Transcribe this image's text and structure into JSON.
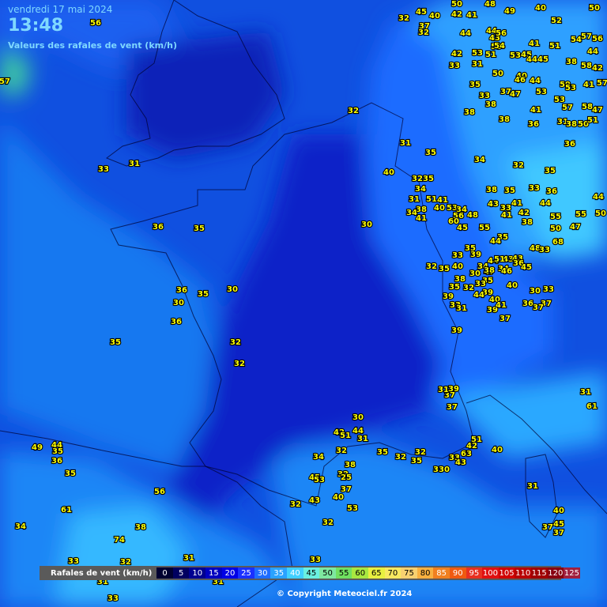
{
  "header": {
    "date": "vendredi 17 mai 2024",
    "time": "13:48",
    "title": "Valeurs des rafales de vent (km/h)"
  },
  "legend": {
    "label": "Rafales de vent (km/h)",
    "items": [
      {
        "v": "0",
        "c": "#000030"
      },
      {
        "v": "5",
        "c": "#000060"
      },
      {
        "v": "10",
        "c": "#000090"
      },
      {
        "v": "15",
        "c": "#0000c0"
      },
      {
        "v": "20",
        "c": "#0000e6"
      },
      {
        "v": "25",
        "c": "#1a30ff"
      },
      {
        "v": "30",
        "c": "#1e6cff"
      },
      {
        "v": "35",
        "c": "#2aa2ff"
      },
      {
        "v": "40",
        "c": "#40d0ff"
      },
      {
        "v": "45",
        "c": "#6af0e0"
      },
      {
        "v": "50",
        "c": "#7ee8a0"
      },
      {
        "v": "55",
        "c": "#70e060"
      },
      {
        "v": "60",
        "c": "#a8e840"
      },
      {
        "v": "65",
        "c": "#e8f040"
      },
      {
        "v": "70",
        "c": "#f8e860"
      },
      {
        "v": "75",
        "c": "#f8d070"
      },
      {
        "v": "80",
        "c": "#f8b040"
      },
      {
        "v": "85",
        "c": "#f08020"
      },
      {
        "v": "90",
        "c": "#f05a10"
      },
      {
        "v": "95",
        "c": "#e83020"
      },
      {
        "v": "100",
        "c": "#e01010"
      },
      {
        "v": "105",
        "c": "#d00000"
      },
      {
        "v": "110",
        "c": "#b80000"
      },
      {
        "v": "115",
        "c": "#a00000"
      },
      {
        "v": "120",
        "c": "#880010"
      },
      {
        "v": "125",
        "c": "#a02040"
      }
    ]
  },
  "copyright": "© Copyright Meteociel.fr 2024",
  "stations": [
    [
      "56",
      121,
      28
    ],
    [
      "57",
      6,
      102
    ],
    [
      "32",
      511,
      22
    ],
    [
      "45",
      533,
      14
    ],
    [
      "40",
      550,
      19
    ],
    [
      "37",
      537,
      32
    ],
    [
      "32",
      536,
      40
    ],
    [
      "50",
      578,
      4
    ],
    [
      "42",
      578,
      17
    ],
    [
      "41",
      597,
      18
    ],
    [
      "48",
      620,
      4
    ],
    [
      "49",
      645,
      13
    ],
    [
      "40",
      684,
      9
    ],
    [
      "52",
      704,
      25
    ],
    [
      "50",
      752,
      9
    ],
    [
      "44",
      589,
      41
    ],
    [
      "44",
      622,
      38
    ],
    [
      "43",
      626,
      47
    ],
    [
      "56",
      634,
      41
    ],
    [
      "53",
      628,
      58
    ],
    [
      "54",
      632,
      57
    ],
    [
      "42",
      578,
      67
    ],
    [
      "53",
      604,
      66
    ],
    [
      "51",
      621,
      68
    ],
    [
      "31",
      604,
      80
    ],
    [
      "33",
      575,
      82
    ],
    [
      "50",
      630,
      92
    ],
    [
      "53",
      652,
      69
    ],
    [
      "41",
      676,
      54
    ],
    [
      "45",
      666,
      68
    ],
    [
      "44",
      673,
      74
    ],
    [
      "45",
      687,
      74
    ],
    [
      "51",
      702,
      57
    ],
    [
      "54",
      729,
      49
    ],
    [
      "57",
      742,
      45
    ],
    [
      "56",
      756,
      48
    ],
    [
      "44",
      750,
      64
    ],
    [
      "38",
      723,
      77
    ],
    [
      "58",
      742,
      82
    ],
    [
      "42",
      756,
      85
    ],
    [
      "59",
      715,
      106
    ],
    [
      "53",
      722,
      110
    ],
    [
      "41",
      745,
      106
    ],
    [
      "57",
      762,
      104
    ],
    [
      "35",
      601,
      106
    ],
    [
      "40",
      660,
      95
    ],
    [
      "46",
      658,
      100
    ],
    [
      "37",
      640,
      115
    ],
    [
      "47",
      652,
      118
    ],
    [
      "44",
      677,
      101
    ],
    [
      "53",
      685,
      115
    ],
    [
      "33",
      613,
      120
    ],
    [
      "38",
      621,
      131
    ],
    [
      "53",
      708,
      125
    ],
    [
      "57",
      718,
      135
    ],
    [
      "58",
      743,
      134
    ],
    [
      "47",
      756,
      138
    ],
    [
      "38",
      594,
      141
    ],
    [
      "38",
      638,
      150
    ],
    [
      "41",
      678,
      138
    ],
    [
      "36",
      675,
      156
    ],
    [
      "31",
      712,
      153
    ],
    [
      "38",
      723,
      156
    ],
    [
      "50",
      738,
      156
    ],
    [
      "51",
      750,
      151
    ],
    [
      "36",
      721,
      181
    ],
    [
      "32",
      447,
      139
    ],
    [
      "31",
      513,
      180
    ],
    [
      "35",
      545,
      192
    ],
    [
      "34",
      607,
      201
    ],
    [
      "32",
      656,
      208
    ],
    [
      "35",
      696,
      215
    ],
    [
      "40",
      492,
      217
    ],
    [
      "33",
      131,
      213
    ],
    [
      "31",
      170,
      206
    ],
    [
      "32",
      528,
      225
    ],
    [
      "35",
      542,
      225
    ],
    [
      "34",
      532,
      238
    ],
    [
      "31",
      524,
      251
    ],
    [
      "51",
      546,
      251
    ],
    [
      "41",
      560,
      252
    ],
    [
      "38",
      622,
      239
    ],
    [
      "35",
      645,
      240
    ],
    [
      "33",
      676,
      237
    ],
    [
      "36",
      698,
      241
    ],
    [
      "44",
      757,
      248
    ],
    [
      "43",
      624,
      257
    ],
    [
      "41",
      654,
      256
    ],
    [
      "44",
      690,
      256
    ],
    [
      "40",
      556,
      262
    ],
    [
      "53",
      572,
      262
    ],
    [
      "34",
      584,
      264
    ],
    [
      "33",
      640,
      262
    ],
    [
      "42",
      663,
      268
    ],
    [
      "55",
      703,
      273
    ],
    [
      "55",
      735,
      270
    ],
    [
      "50",
      760,
      269
    ],
    [
      "38",
      533,
      264
    ],
    [
      "34",
      521,
      268
    ],
    [
      "56",
      580,
      272
    ],
    [
      "48",
      598,
      271
    ],
    [
      "41",
      641,
      271
    ],
    [
      "38",
      667,
      280
    ],
    [
      "41",
      533,
      275
    ],
    [
      "60",
      574,
      279
    ],
    [
      "47",
      728,
      286
    ],
    [
      "45",
      585,
      287
    ],
    [
      "55",
      613,
      287
    ],
    [
      "50",
      703,
      288
    ],
    [
      "30",
      464,
      283
    ],
    [
      "36",
      200,
      286
    ],
    [
      "35",
      252,
      288
    ],
    [
      "35",
      636,
      299
    ],
    [
      "44",
      627,
      304
    ],
    [
      "68",
      706,
      305
    ],
    [
      "35",
      595,
      313
    ],
    [
      "39",
      602,
      321
    ],
    [
      "48",
      677,
      313
    ],
    [
      "33",
      689,
      315
    ],
    [
      "33",
      579,
      322
    ],
    [
      "43",
      643,
      327
    ],
    [
      "44",
      624,
      329
    ],
    [
      "51",
      632,
      327
    ],
    [
      "43",
      655,
      326
    ],
    [
      "32",
      546,
      336
    ],
    [
      "35",
      562,
      339
    ],
    [
      "40",
      579,
      336
    ],
    [
      "34",
      611,
      336
    ],
    [
      "47",
      619,
      343
    ],
    [
      "34",
      637,
      339
    ],
    [
      "36",
      656,
      332
    ],
    [
      "45",
      666,
      337
    ],
    [
      "38",
      619,
      341
    ],
    [
      "30",
      601,
      345
    ],
    [
      "38",
      582,
      352
    ],
    [
      "46",
      641,
      342
    ],
    [
      "35",
      617,
      354
    ],
    [
      "30",
      294,
      365
    ],
    [
      "36",
      230,
      366
    ],
    [
      "35",
      257,
      371
    ],
    [
      "30",
      226,
      382
    ],
    [
      "35",
      575,
      362
    ],
    [
      "32",
      593,
      363
    ],
    [
      "33",
      608,
      358
    ],
    [
      "39",
      617,
      369
    ],
    [
      "40",
      648,
      360
    ],
    [
      "30",
      677,
      367
    ],
    [
      "33",
      694,
      365
    ],
    [
      "39",
      567,
      374
    ],
    [
      "44",
      606,
      372
    ],
    [
      "40",
      626,
      378
    ],
    [
      "36",
      668,
      383
    ],
    [
      "37",
      691,
      383
    ],
    [
      "33",
      576,
      385
    ],
    [
      "31",
      584,
      389
    ],
    [
      "39",
      623,
      391
    ],
    [
      "41",
      634,
      385
    ],
    [
      "37",
      681,
      388
    ],
    [
      "36",
      223,
      406
    ],
    [
      "37",
      639,
      402
    ],
    [
      "35",
      146,
      432
    ],
    [
      "39",
      578,
      417
    ],
    [
      "32",
      298,
      432
    ],
    [
      "32",
      303,
      459
    ],
    [
      "37",
      569,
      499
    ],
    [
      "31",
      561,
      492
    ],
    [
      "39",
      574,
      491
    ],
    [
      "37",
      572,
      514
    ],
    [
      "31",
      741,
      495
    ],
    [
      "61",
      749,
      513
    ],
    [
      "30",
      453,
      527
    ],
    [
      "42",
      429,
      546
    ],
    [
      "51",
      437,
      550
    ],
    [
      "44",
      453,
      544
    ],
    [
      "31",
      459,
      554
    ],
    [
      "32",
      432,
      569
    ],
    [
      "34",
      403,
      577
    ],
    [
      "38",
      443,
      587
    ],
    [
      "35",
      484,
      571
    ],
    [
      "32",
      507,
      577
    ],
    [
      "32",
      532,
      571
    ],
    [
      "35",
      527,
      582
    ],
    [
      "33",
      575,
      578
    ],
    [
      "43",
      583,
      584
    ],
    [
      "63",
      590,
      573
    ],
    [
      "42",
      597,
      563
    ],
    [
      "51",
      603,
      555
    ],
    [
      "40",
      629,
      568
    ],
    [
      "33",
      555,
      593
    ],
    [
      "30",
      562,
      593
    ],
    [
      "45",
      398,
      603
    ],
    [
      "53",
      404,
      606
    ],
    [
      "32",
      434,
      599
    ],
    [
      "25",
      438,
      603
    ],
    [
      "37",
      438,
      618
    ],
    [
      "49",
      47,
      565
    ],
    [
      "44",
      72,
      562
    ],
    [
      "35",
      73,
      570
    ],
    [
      "36",
      72,
      582
    ],
    [
      "35",
      89,
      598
    ],
    [
      "56",
      202,
      621
    ],
    [
      "40",
      428,
      628
    ],
    [
      "53",
      446,
      642
    ],
    [
      "32",
      374,
      637
    ],
    [
      "43",
      398,
      632
    ],
    [
      "31",
      674,
      614
    ],
    [
      "40",
      707,
      645
    ],
    [
      "37",
      693,
      666
    ],
    [
      "45",
      707,
      662
    ],
    [
      "37",
      707,
      673
    ],
    [
      "61",
      84,
      644
    ],
    [
      "32",
      415,
      660
    ],
    [
      "38",
      178,
      666
    ],
    [
      "34",
      26,
      665
    ],
    [
      "74",
      151,
      682
    ],
    [
      "32",
      159,
      710
    ],
    [
      "31",
      239,
      705
    ],
    [
      "33",
      399,
      707
    ],
    [
      "33",
      93,
      709
    ],
    [
      "31",
      130,
      735
    ],
    [
      "31",
      276,
      735
    ],
    [
      "33",
      143,
      756
    ]
  ]
}
